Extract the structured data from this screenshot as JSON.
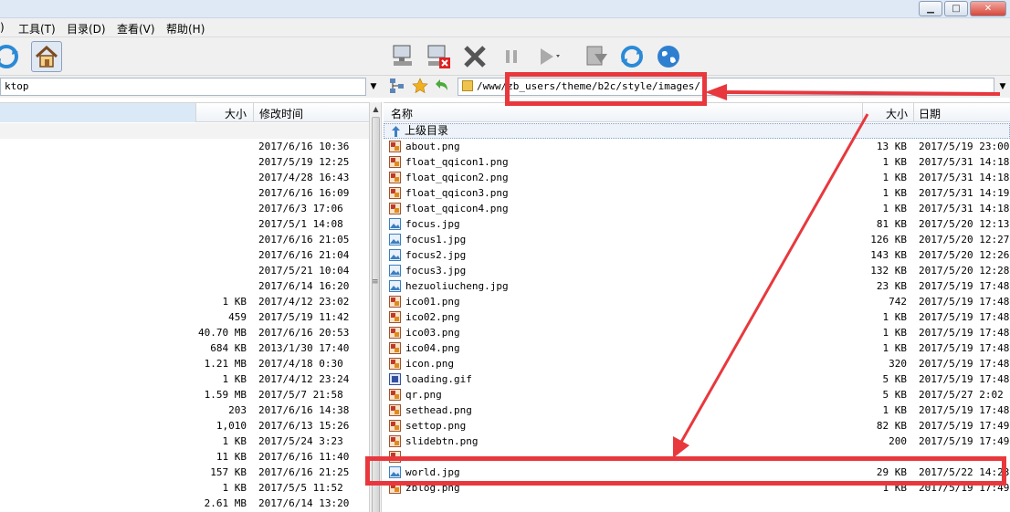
{
  "menu": [
    "工具(T)",
    "目录(D)",
    "查看(V)",
    "帮助(H)"
  ],
  "menu_partial_left": ")",
  "window_controls": [
    "minimize-icon",
    "maximize-icon",
    "close-icon"
  ],
  "left_toolbar_icons": [
    "refresh-icon",
    "home-icon"
  ],
  "right_toolbar_icons": [
    "connect-icon",
    "disconnect-icon",
    "cancel-icon",
    "pause-icon",
    "play-icon",
    "queue-icon",
    "refresh-icon",
    "globe-icon"
  ],
  "left_path": "ktop",
  "right_path": "/www/zb_users/theme/b2c/style/images/",
  "left_headers": {
    "size": "大小",
    "modified": "修改时间"
  },
  "right_headers": {
    "name": "名称",
    "size": "大小",
    "date": "日期"
  },
  "parent_dir_label": "上级目录",
  "left_rows": [
    {
      "size": "",
      "modified": "2017/6/16 10:36"
    },
    {
      "size": "",
      "modified": "2017/5/19 12:25"
    },
    {
      "size": "",
      "modified": "2017/4/28 16:43"
    },
    {
      "size": "",
      "modified": "2017/6/16 16:09"
    },
    {
      "size": "",
      "modified": "2017/6/3 17:06"
    },
    {
      "size": "",
      "modified": "2017/5/1 14:08"
    },
    {
      "size": "",
      "modified": "2017/6/16 21:05"
    },
    {
      "size": "",
      "modified": "2017/6/16 21:04"
    },
    {
      "size": "",
      "modified": "2017/5/21 10:04"
    },
    {
      "size": "",
      "modified": "2017/6/14 16:20"
    },
    {
      "size": "1 KB",
      "modified": "2017/4/12 23:02"
    },
    {
      "size": "459",
      "modified": "2017/5/19 11:42"
    },
    {
      "size": "40.70 MB",
      "modified": "2017/6/16 20:53"
    },
    {
      "size": "684 KB",
      "modified": "2013/1/30 17:40"
    },
    {
      "size": "1.21 MB",
      "modified": "2017/4/18 0:30"
    },
    {
      "size": "1 KB",
      "modified": "2017/4/12 23:24"
    },
    {
      "size": "1.59 MB",
      "modified": "2017/5/7 21:58"
    },
    {
      "size": "203",
      "modified": "2017/6/16 14:38"
    },
    {
      "size": "1,010",
      "modified": "2017/6/13 15:26"
    },
    {
      "size": "1 KB",
      "modified": "2017/5/24 3:23"
    },
    {
      "size": "11 KB",
      "modified": "2017/6/16 11:40"
    },
    {
      "size": "157 KB",
      "modified": "2017/6/16 21:25"
    },
    {
      "size": "1 KB",
      "modified": "2017/5/5 11:52"
    },
    {
      "size": "2.61 MB",
      "modified": "2017/6/14 13:20"
    }
  ],
  "right_rows": [
    {
      "name": "about.png",
      "size": "13 KB",
      "date": "2017/5/19 23:00",
      "icon": "png-file-icon"
    },
    {
      "name": "float_qqicon1.png",
      "size": "1 KB",
      "date": "2017/5/31 14:18",
      "icon": "png-file-icon"
    },
    {
      "name": "float_qqicon2.png",
      "size": "1 KB",
      "date": "2017/5/31 14:18",
      "icon": "png-file-icon"
    },
    {
      "name": "float_qqicon3.png",
      "size": "1 KB",
      "date": "2017/5/31 14:19",
      "icon": "png-file-icon"
    },
    {
      "name": "float_qqicon4.png",
      "size": "1 KB",
      "date": "2017/5/31 14:18",
      "icon": "png-file-icon"
    },
    {
      "name": "focus.jpg",
      "size": "81 KB",
      "date": "2017/5/20 12:13",
      "icon": "jpg-file-icon"
    },
    {
      "name": "focus1.jpg",
      "size": "126 KB",
      "date": "2017/5/20 12:27",
      "icon": "jpg-file-icon"
    },
    {
      "name": "focus2.jpg",
      "size": "143 KB",
      "date": "2017/5/20 12:26",
      "icon": "jpg-file-icon"
    },
    {
      "name": "focus3.jpg",
      "size": "132 KB",
      "date": "2017/5/20 12:28",
      "icon": "jpg-file-icon"
    },
    {
      "name": "hezuoliucheng.jpg",
      "size": "23 KB",
      "date": "2017/5/19 17:48",
      "icon": "jpg-file-icon"
    },
    {
      "name": "ico01.png",
      "size": "742",
      "date": "2017/5/19 17:48",
      "icon": "png-file-icon"
    },
    {
      "name": "ico02.png",
      "size": "1 KB",
      "date": "2017/5/19 17:48",
      "icon": "png-file-icon"
    },
    {
      "name": "ico03.png",
      "size": "1 KB",
      "date": "2017/5/19 17:48",
      "icon": "png-file-icon"
    },
    {
      "name": "ico04.png",
      "size": "1 KB",
      "date": "2017/5/19 17:48",
      "icon": "png-file-icon"
    },
    {
      "name": "icon.png",
      "size": "320",
      "date": "2017/5/19 17:48",
      "icon": "png-file-icon"
    },
    {
      "name": "loading.gif",
      "size": "5 KB",
      "date": "2017/5/19 17:48",
      "icon": "gif-file-icon"
    },
    {
      "name": "qr.png",
      "size": "5 KB",
      "date": "2017/5/27 2:02",
      "icon": "png-file-icon"
    },
    {
      "name": "sethead.png",
      "size": "1 KB",
      "date": "2017/5/19 17:48",
      "icon": "png-file-icon"
    },
    {
      "name": "settop.png",
      "size": "82 KB",
      "date": "2017/5/19 17:49",
      "icon": "png-file-icon"
    },
    {
      "name": "slidebtn.png",
      "size": "200",
      "date": "2017/5/19 17:49",
      "icon": "png-file-icon"
    },
    {
      "name": "",
      "size": "",
      "date": "",
      "icon": "png-file-icon"
    },
    {
      "name": "world.jpg",
      "size": "29 KB",
      "date": "2017/5/22 14:23",
      "icon": "jpg-file-icon"
    },
    {
      "name": "zblog.png",
      "size": "1 KB",
      "date": "2017/5/19 17:49",
      "icon": "png-file-icon"
    }
  ],
  "colors": {
    "annotation": "#e8383d",
    "selected_header": "#dbe9f7",
    "png_icon": "#c0392b",
    "jpg_icon": "#3a7fc1"
  }
}
